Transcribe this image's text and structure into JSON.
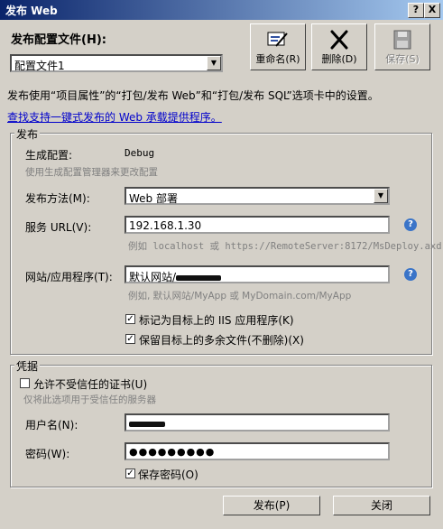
{
  "window": {
    "title": "发布 Web",
    "help_btn": "?",
    "close_btn": "X"
  },
  "profile": {
    "label": "发布配置文件(H):",
    "selected": "配置文件1",
    "rename": "重命名(R)",
    "delete": "删除(D)",
    "save": "保存(S)"
  },
  "description": "发布使用“项目属性”的“打包/发布 Web”和“打包/发布 SQL”选项卡中的设置。",
  "link": "查找支持一键式发布的 Web 承载提供程序。",
  "publish": {
    "legend": "发布",
    "build_config_label": "生成配置:",
    "build_config_value": "Debug",
    "build_config_hint": "使用生成配置管理器来更改配置",
    "method_label": "发布方法(M):",
    "method_value": "Web 部署",
    "service_url_label": "服务 URL(V):",
    "service_url_value": "192.168.1.30",
    "service_url_hint": "例如 localhost 或 https://RemoteServer:8172/MsDeploy.axd",
    "site_label": "网站/应用程序(T):",
    "site_value": "默认网站/",
    "site_hint": "例如, 默认网站/MyApp 或 MyDomain.com/MyApp",
    "mark_iis_label": "标记为目标上的 IIS 应用程序(K)",
    "mark_iis_checked": true,
    "keep_files_label": "保留目标上的多余文件(不删除)(X)",
    "keep_files_checked": true
  },
  "credentials": {
    "legend": "凭据",
    "allow_untrusted_label": "允许不受信任的证书(U)",
    "allow_untrusted_checked": false,
    "allow_untrusted_hint": "仅将此选项用于受信任的服务器",
    "username_label": "用户名(N):",
    "password_label": "密码(W):",
    "password_value": "●●●●●●●●●",
    "save_password_label": "保存密码(O)",
    "save_password_checked": true
  },
  "footer": {
    "publish": "发布(P)",
    "close": "关闭"
  },
  "colors": {
    "titlebar_start": "#0a246a",
    "titlebar_end": "#a6caf0",
    "link": "#0000cc",
    "help_icon": "#3a74c8"
  }
}
